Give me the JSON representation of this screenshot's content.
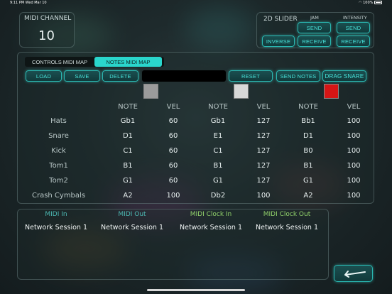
{
  "status_bar": {
    "time_date": "9:11 PM   Wed Mar 10",
    "battery": "100%"
  },
  "midi_channel": {
    "label": "MIDI CHANNEL",
    "value": "10"
  },
  "slider_2d": {
    "label": "2D SLIDER",
    "jam_label": "JAM",
    "intensity_label": "INTENSITY",
    "send_label": "SEND",
    "receive_label": "RECEIVE",
    "inverse_label": "INVERSE"
  },
  "tabs": [
    {
      "label": "CONTROLS MIDI MAP",
      "active": false
    },
    {
      "label": "NOTES MIDI MAP",
      "active": true
    }
  ],
  "toolbar": {
    "load": "LOAD",
    "save": "SAVE",
    "delete": "DELETE",
    "name_value": "",
    "reset": "RESET",
    "send_notes": "SEND NOTES",
    "drag_snare": "DRAG SNARE"
  },
  "swatches": [
    "#9b9b9b",
    "#d8d8d8",
    "#d51515"
  ],
  "table": {
    "headers": [
      "NOTE",
      "VEL",
      "NOTE",
      "VEL",
      "NOTE",
      "VEL"
    ],
    "rows": [
      {
        "name": "Hats",
        "cells": [
          "Gb1",
          "60",
          "Gb1",
          "127",
          "Bb1",
          "100"
        ]
      },
      {
        "name": "Snare",
        "cells": [
          "D1",
          "60",
          "E1",
          "127",
          "D1",
          "100"
        ]
      },
      {
        "name": "Kick",
        "cells": [
          "C1",
          "60",
          "C1",
          "127",
          "B0",
          "100"
        ]
      },
      {
        "name": "Tom1",
        "cells": [
          "B1",
          "60",
          "B1",
          "127",
          "B1",
          "100"
        ]
      },
      {
        "name": "Tom2",
        "cells": [
          "G1",
          "60",
          "G1",
          "127",
          "G1",
          "100"
        ]
      },
      {
        "name": "Crash Cymbals",
        "cells": [
          "A2",
          "100",
          "Db2",
          "100",
          "A2",
          "100"
        ]
      }
    ]
  },
  "sessions": [
    {
      "label": "MIDI In",
      "value": "Network Session 1",
      "color": "#4cb8b2"
    },
    {
      "label": "MIDI Out",
      "value": "Network Session 1",
      "color": "#4cb8b2"
    },
    {
      "label": "MIDI Clock In",
      "value": "Network Session 1",
      "color": "#8fcf6a"
    },
    {
      "label": "MIDI Clock Out",
      "value": "Network Session 1",
      "color": "#8fcf6a"
    }
  ],
  "return_icon": "return-arrow-icon"
}
